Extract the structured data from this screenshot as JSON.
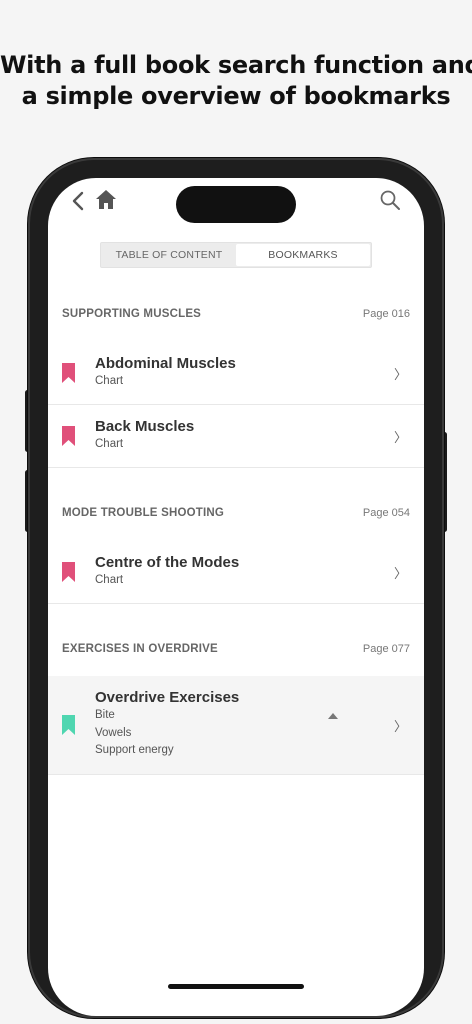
{
  "headline": {
    "line1": "With a full book search function and",
    "line2": "a simple overview of bookmarks"
  },
  "nav": {
    "back_icon": "chevron-left-icon",
    "home_icon": "home-icon",
    "search_icon": "search-icon"
  },
  "tabs": [
    {
      "label": "TABLE OF CONTENT",
      "active": false
    },
    {
      "label": "BOOKMARKS",
      "active": true
    }
  ],
  "sections": [
    {
      "title": "SUPPORTING MUSCLES",
      "page": "Page 016",
      "items": [
        {
          "title": "Abdominal Muscles",
          "subs": [
            "Chart"
          ],
          "bookmark_color": "#e0507a"
        },
        {
          "title": "Back Muscles",
          "subs": [
            "Chart"
          ],
          "bookmark_color": "#e0507a"
        }
      ]
    },
    {
      "title": "MODE TROUBLE SHOOTING",
      "page": "Page 054",
      "items": [
        {
          "title": "Centre of the Modes",
          "subs": [
            "Chart"
          ],
          "bookmark_color": "#e0507a"
        }
      ]
    },
    {
      "title": "EXERCISES IN OVERDRIVE",
      "page": "Page 077",
      "items": [
        {
          "title": "Overdrive Exercises",
          "subs": [
            "Bite",
            "Vowels",
            "Support energy"
          ],
          "bookmark_color": "#4fd6b0",
          "expanded": true
        }
      ]
    }
  ],
  "chevron_glyph": "〉"
}
